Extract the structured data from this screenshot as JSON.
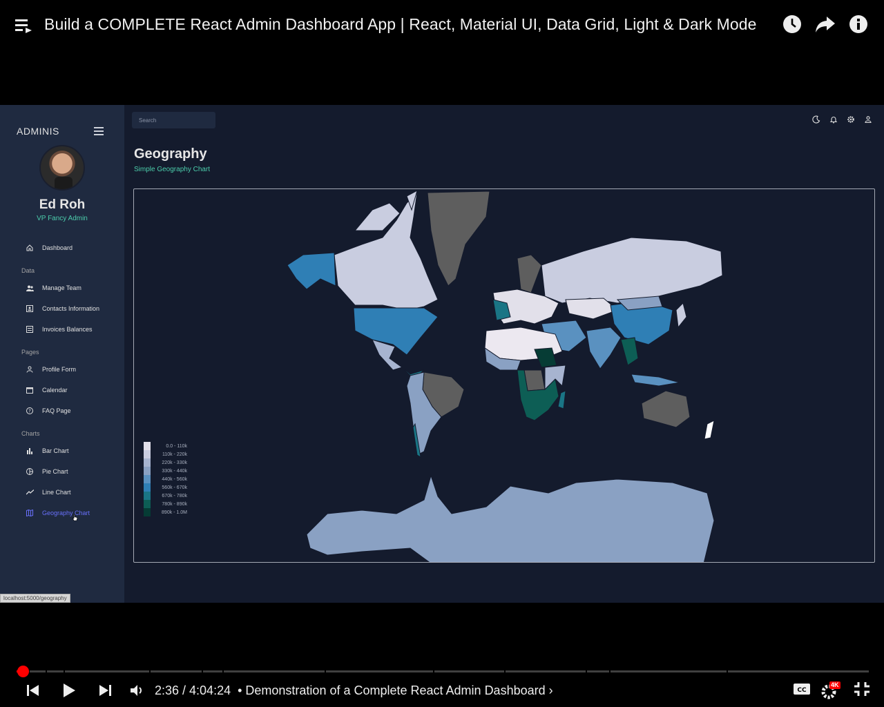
{
  "player": {
    "title": "Build a COMPLETE React Admin Dashboard App | React, Material UI, Data Grid, Light & Dark Mode",
    "time_display": "2:36 / 4:04:24",
    "chapter": "• Demonstration of a Complete React Admin Dashboard ›",
    "progress": 0.0107,
    "quality_badge": "4K",
    "icons": [
      "playlist-icon",
      "watch-later-icon",
      "share-icon",
      "info-icon",
      "previous-icon",
      "play-icon",
      "next-icon",
      "volume-icon",
      "captions-icon",
      "settings-icon",
      "fullscreen-exit-icon"
    ]
  },
  "app": {
    "brand": "ADMINIS",
    "user": {
      "name": "Ed Roh",
      "role": "VP Fancy Admin"
    },
    "nav": {
      "dashboard": "Dashboard",
      "section_data": "Data",
      "manage_team": "Manage Team",
      "contacts": "Contacts Information",
      "invoices": "Invoices Balances",
      "section_pages": "Pages",
      "profile": "Profile Form",
      "calendar": "Calendar",
      "faq": "FAQ Page",
      "section_charts": "Charts",
      "bar": "Bar Chart",
      "pie": "Pie Chart",
      "line": "Line Chart",
      "geography": "Geography Chart"
    },
    "active_nav": "geography",
    "search": {
      "placeholder": "Search",
      "value": ""
    },
    "page": {
      "title": "Geography",
      "subtitle": "Simple Geography Chart"
    },
    "status_url": "localhost:5000/geography",
    "colors": {
      "bg": "#141b2d",
      "sidebar": "#1f2a40",
      "accent_green": "#4cceac",
      "active_blue": "#6870fa",
      "no_data": "#666666"
    },
    "legend": [
      {
        "label": "0.0 - 110k",
        "color": "#e2e0ea"
      },
      {
        "label": "110k - 220k",
        "color": "#c9cde0"
      },
      {
        "label": "220k - 330k",
        "color": "#a7b4d0"
      },
      {
        "label": "330k - 440k",
        "color": "#8aa1c3"
      },
      {
        "label": "440k - 560k",
        "color": "#5a91c0"
      },
      {
        "label": "560k - 670k",
        "color": "#2f7fb5"
      },
      {
        "label": "670k - 780k",
        "color": "#1a7585"
      },
      {
        "label": "780k - 890k",
        "color": "#0d5e55"
      },
      {
        "label": "890k - 1.0M",
        "color": "#063c35"
      }
    ]
  }
}
